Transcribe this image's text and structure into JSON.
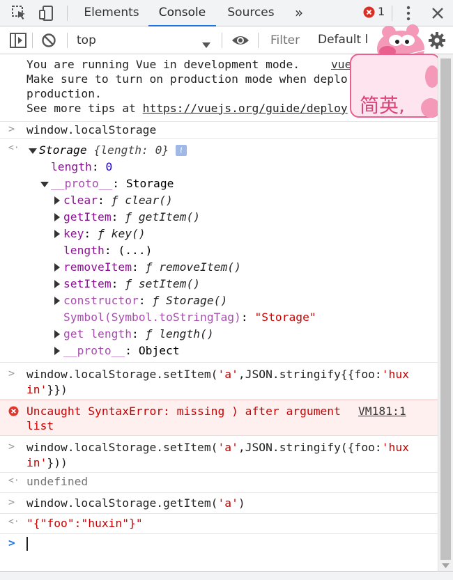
{
  "tabs": {
    "elements": "Elements",
    "console": "Console",
    "sources": "Sources",
    "more": "»",
    "error_count": "1"
  },
  "toolbar": {
    "context": "top",
    "filter_placeholder": "Filter",
    "levels": "Default l",
    "sticker_text": "简英,"
  },
  "console": {
    "vue_msg": {
      "line1": "You are running Vue in development mode.",
      "line1_src": "vue",
      "line2": "Make sure to turn on production mode when deplo",
      "line3": "production.",
      "line4_prefix": "See more tips at ",
      "line4_link": "https://vuejs.org/guide/deploy"
    },
    "cmd1": "window.localStorage",
    "result1": {
      "header_name": "Storage",
      "header_meta": "{length: 0}",
      "info": "i",
      "length_key": "length",
      "length_val": "0",
      "proto_key": "__proto__",
      "proto_val": "Storage",
      "clear_key": "clear",
      "clear_val": "ƒ clear()",
      "getItem_key": "getItem",
      "getItem_val": "ƒ getItem()",
      "key_key": "key",
      "key_val": "ƒ key()",
      "length2_key": "length",
      "length2_val": "(...)",
      "removeItem_key": "removeItem",
      "removeItem_val": "ƒ removeItem()",
      "setItem_key": "setItem",
      "setItem_val": "ƒ setItem()",
      "constructor_key": "constructor",
      "constructor_val": "ƒ Storage()",
      "symbol_key": "Symbol(Symbol.toStringTag)",
      "symbol_val": "\"Storage\"",
      "getlength_key": "get length",
      "getlength_val": "ƒ length()",
      "proto2_key": "__proto__",
      "proto2_val": "Object"
    },
    "cmd2": {
      "a": "window.localStorage.setItem(",
      "b": "'a'",
      "c": ",JSON.stringify{{foo:",
      "d": "'hux",
      "e": "in'",
      "f": "}})"
    },
    "error": {
      "line1": "Uncaught SyntaxError: missing ) after argument",
      "line2": "list",
      "source": "VM181:1"
    },
    "cmd3": {
      "a": "window.localStorage.setItem(",
      "b": "'a'",
      "c": ",JSON.stringify({foo:",
      "d": "'hux",
      "e": "in'",
      "f": "}))"
    },
    "result3": "undefined",
    "cmd4": {
      "a": "window.localStorage.getItem(",
      "b": "'a'",
      "c": ")"
    },
    "result4": "\"{\"foo\":\"huxin\"}\""
  }
}
